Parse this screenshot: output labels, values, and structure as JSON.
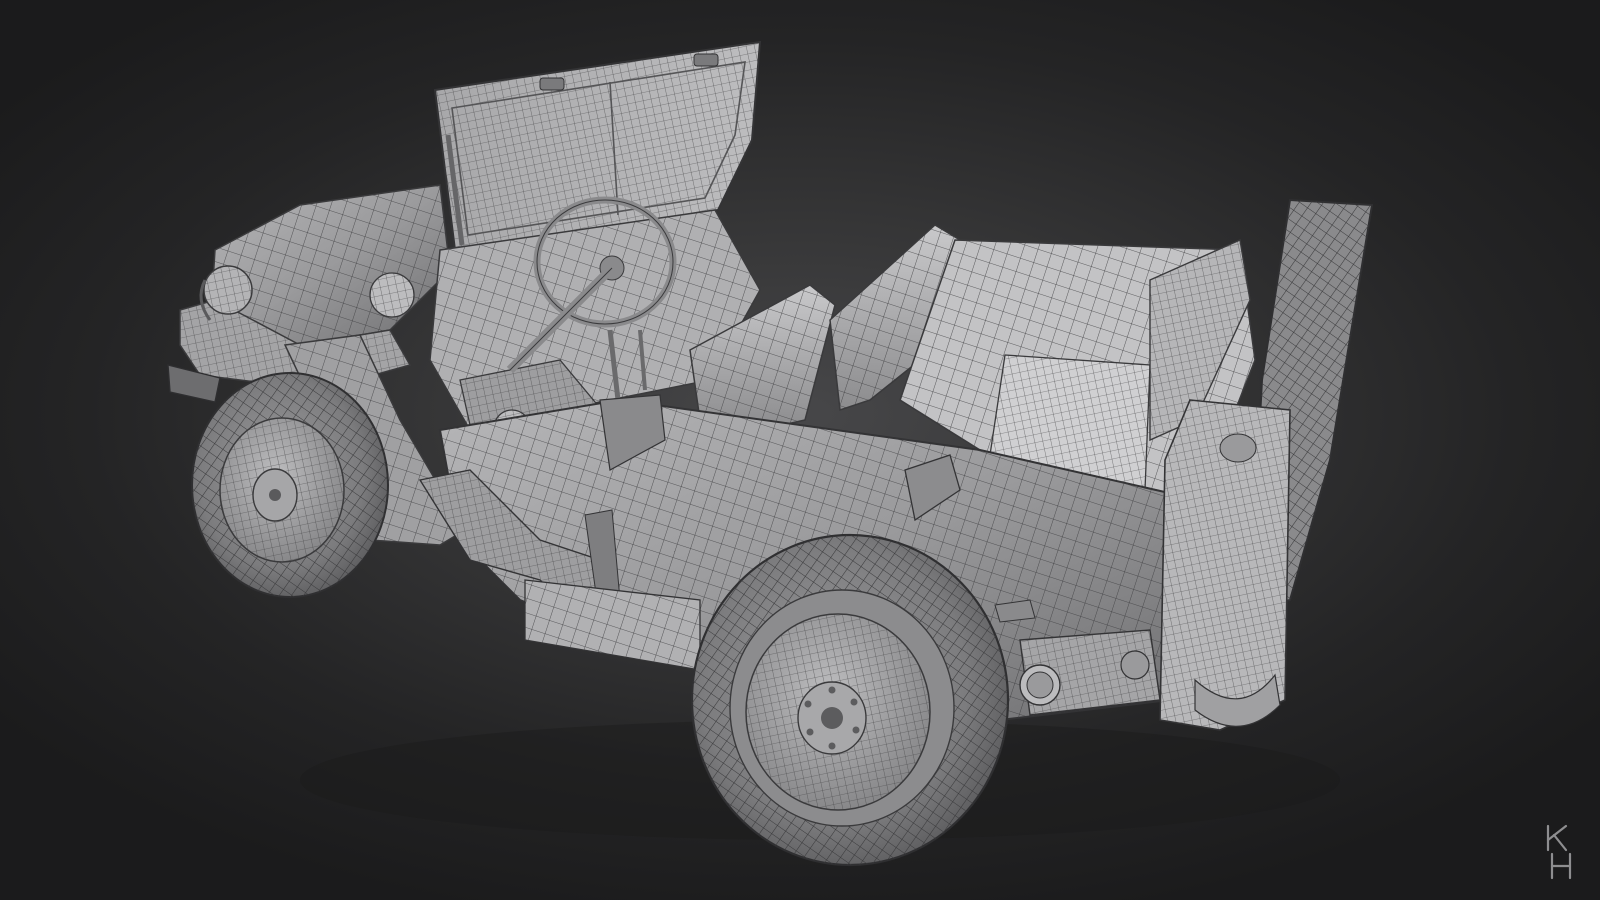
{
  "scene": {
    "subject": "wireframe-jeep-model",
    "background_color": "#2e2e2f",
    "mesh_fill": "#9c9c9e",
    "mesh_highlight": "#d6d6d8",
    "wire_color": "#3a3a3c"
  },
  "signature": {
    "text": "KH",
    "color": "#8e8e90"
  }
}
